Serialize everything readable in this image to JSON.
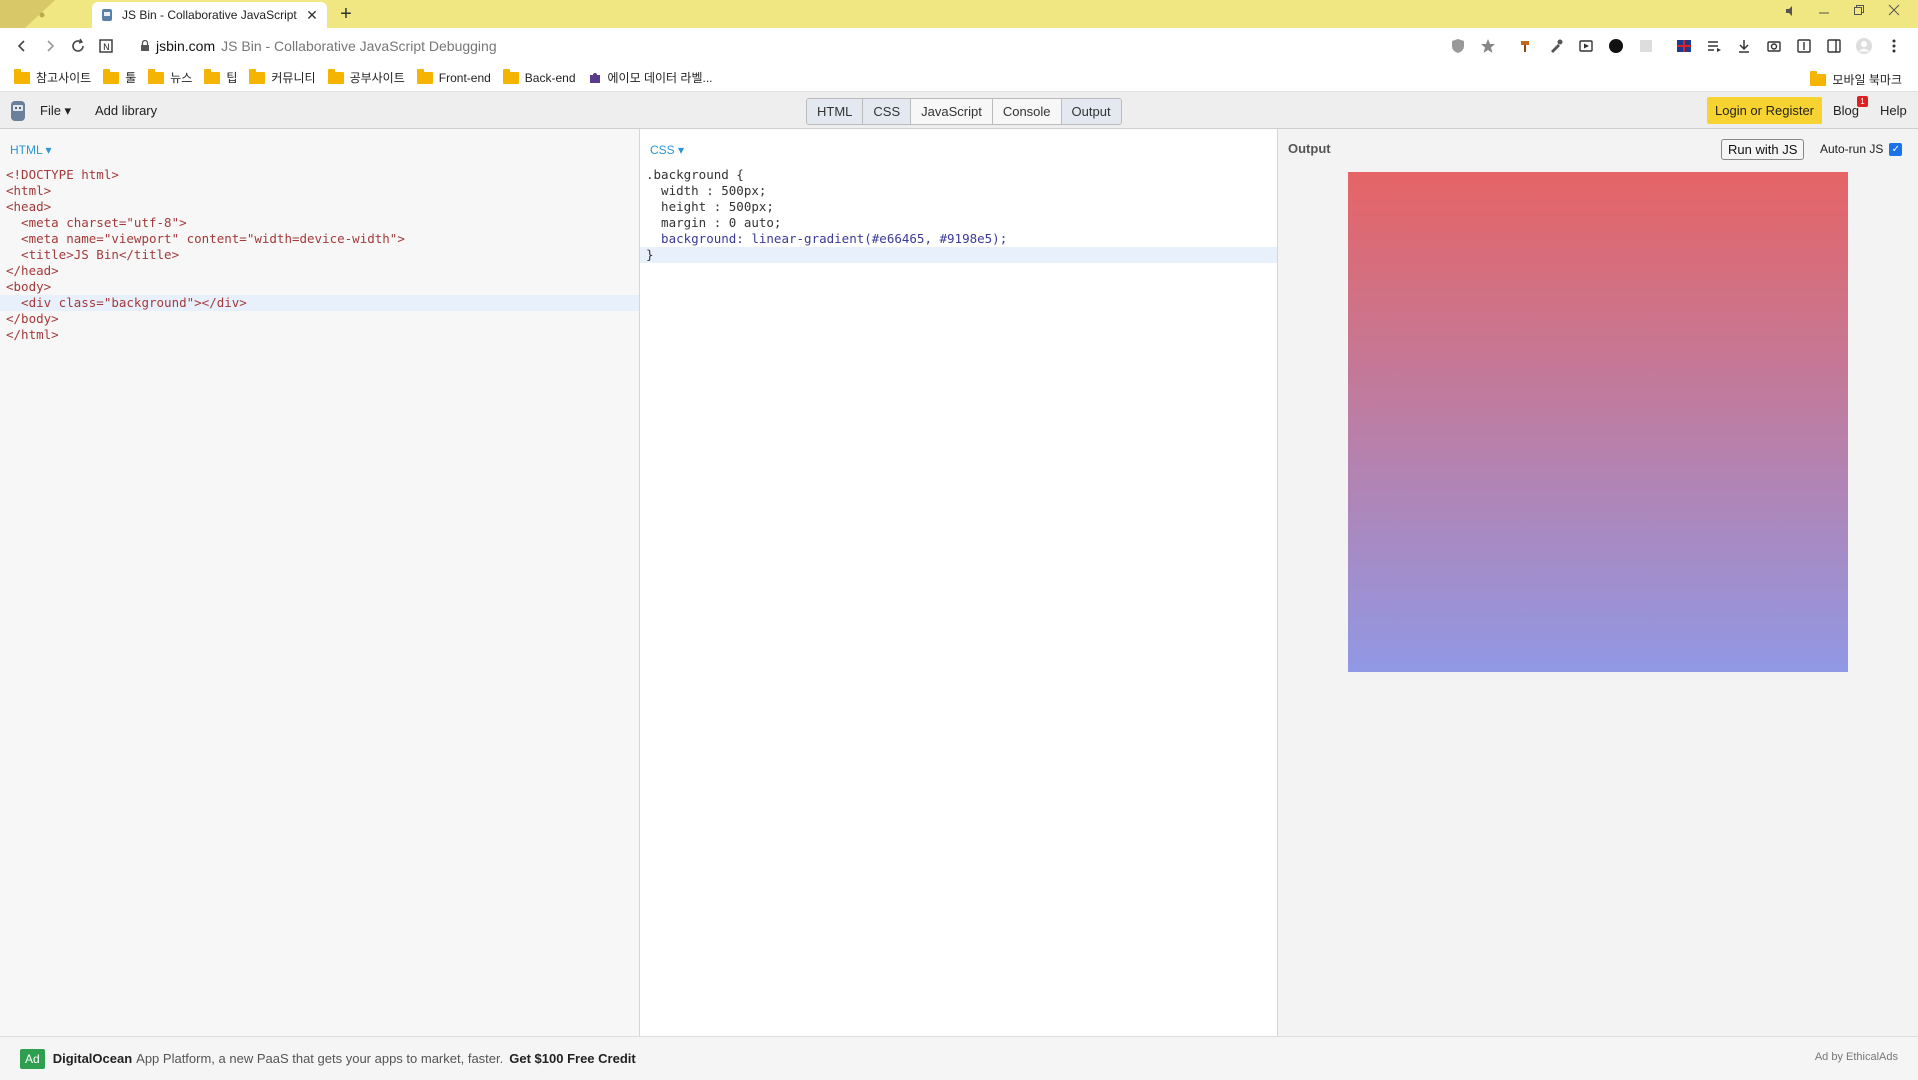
{
  "browser": {
    "tab_title": "JS Bin - Collaborative JavaScript Debugging",
    "url_domain": "jsbin.com",
    "url_rest": "JS Bin - Collaborative JavaScript Debugging",
    "new_tab_label": "+",
    "close_label": "✕"
  },
  "bookmarks": {
    "items": [
      {
        "label": "참고사이트"
      },
      {
        "label": "툴"
      },
      {
        "label": "뉴스"
      },
      {
        "label": "팁"
      },
      {
        "label": "커뮤니티"
      },
      {
        "label": "공부사이트"
      },
      {
        "label": "Front-end"
      },
      {
        "label": "Back-end"
      },
      {
        "label": "에이모 데이터 라벨..."
      }
    ],
    "mobile": "모바일 북마크"
  },
  "jsbin": {
    "file_menu": "File ▾",
    "add_library": "Add library",
    "tabs": [
      "HTML",
      "CSS",
      "JavaScript",
      "Console",
      "Output"
    ],
    "login": "Login or Register",
    "blog": "Blog",
    "blog_badge": "1",
    "help": "Help"
  },
  "html_panel": {
    "label": "HTML ▾",
    "lines": [
      "<!DOCTYPE html>",
      "<html>",
      "<head>",
      "  <meta charset=\"utf-8\">",
      "  <meta name=\"viewport\" content=\"width=device-width\">",
      "  <title>JS Bin</title>",
      "</head>",
      "<body>",
      "  <div class=\"background\"></div>",
      "</body>",
      "</html>"
    ]
  },
  "css_panel": {
    "label": "CSS ▾",
    "lines": [
      ".background {",
      "  width : 500px;",
      "  height : 500px;",
      "  margin : 0 auto;",
      "  background: linear-gradient(#e66465, #9198e5);",
      "}"
    ]
  },
  "output_panel": {
    "label": "Output",
    "run_button": "Run with JS",
    "autorun": "Auto-run JS",
    "gradient_colors": [
      "#e66465",
      "#9198e5"
    ]
  },
  "ad": {
    "badge": "Ad",
    "brand": "DigitalOcean",
    "text": "App Platform, a new PaaS that gets your apps to market, faster.",
    "cta": "Get $100 Free Credit",
    "by": "Ad by EthicalAds"
  }
}
